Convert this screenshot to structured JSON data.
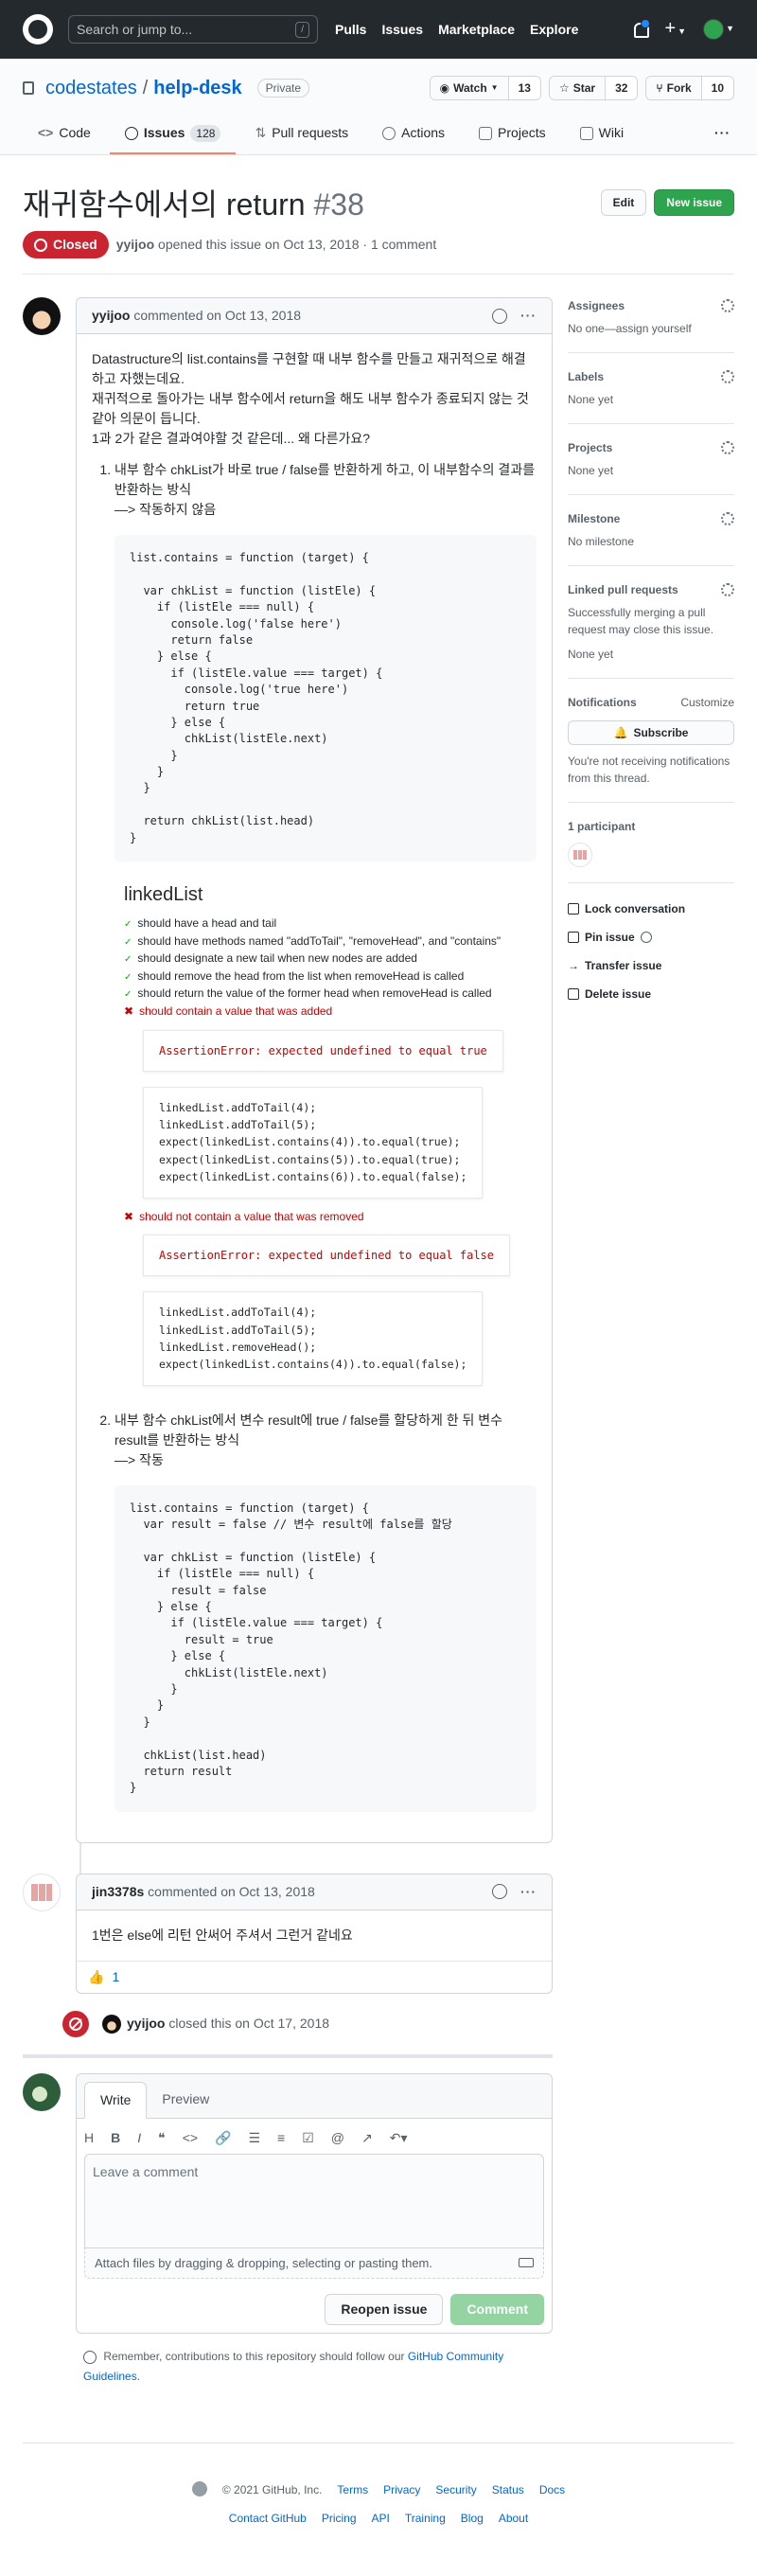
{
  "header": {
    "search_placeholder": "Search or jump to...",
    "slash": "/",
    "nav": [
      "Pulls",
      "Issues",
      "Marketplace",
      "Explore"
    ]
  },
  "repo": {
    "owner": "codestates",
    "name": "help-desk",
    "visibility": "Private",
    "watch_label": "Watch",
    "watch_count": "13",
    "star_label": "Star",
    "star_count": "32",
    "fork_label": "Fork",
    "fork_count": "10",
    "tabs": [
      {
        "label": "Code"
      },
      {
        "label": "Issues",
        "count": "128"
      },
      {
        "label": "Pull requests"
      },
      {
        "label": "Actions"
      },
      {
        "label": "Projects"
      },
      {
        "label": "Wiki"
      }
    ],
    "more": "···"
  },
  "issue": {
    "title": "재귀함수에서의 return",
    "number": "#38",
    "edit_label": "Edit",
    "new_issue_label": "New issue",
    "state": "Closed",
    "author": "yyijoo",
    "opened_text": "opened this issue on Oct 13, 2018 · 1 comment"
  },
  "comment1": {
    "author": "yyijoo",
    "meta": "commented on Oct 13, 2018",
    "p1": "Datastructure의 list.contains를 구현할 때 내부 함수를 만들고 재귀적으로 해결하고 자했는데요.",
    "p2": "재귀적으로 돌아가는 내부 함수에서 return을 해도 내부 함수가 종료되지 않는 것 같아 의문이 듭니다.",
    "p3": "1과 2가 같은 결과여야할 것 같은데... 왜 다른가요?",
    "item1_a": "내부 함수 chkList가 바로 true / false를 반환하게 하고, 이 내부함수의 결과를 반환하는 방식",
    "item1_b": "—> 작동하지 않음",
    "code1": "list.contains = function (target) {\n\n  var chkList = function (listEle) {\n    if (listEle === null) {\n      console.log('false here')\n      return false\n    } else {\n      if (listEle.value === target) {\n        console.log('true here')\n        return true\n      } else {\n        chkList(listEle.next)\n      }\n    }\n  }\n\n  return chkList(list.head)\n}",
    "mocha_title": "linkedList",
    "mocha_pass": [
      "should have a head and tail",
      "should have methods named \"addToTail\", \"removeHead\", and \"contains\"",
      "should designate a new tail when new nodes are added",
      "should remove the head from the list when removeHead is called",
      "should return the value of the former head when removeHead is called"
    ],
    "fail1": "should contain a value that was added",
    "err1": "AssertionError: expected undefined to equal true",
    "src1": "linkedList.addToTail(4);\nlinkedList.addToTail(5);\nexpect(linkedList.contains(4)).to.equal(true);\nexpect(linkedList.contains(5)).to.equal(true);\nexpect(linkedList.contains(6)).to.equal(false);",
    "fail2": "should not contain a value that was removed",
    "err2": "AssertionError: expected undefined to equal false",
    "src2": "linkedList.addToTail(4);\nlinkedList.addToTail(5);\nlinkedList.removeHead();\nexpect(linkedList.contains(4)).to.equal(false);",
    "item2_a": "내부 함수 chkList에서 변수 result에 true / false를 할당하게 한 뒤 변수 result를 반환하는 방식",
    "item2_b": "—> 작동",
    "code2": "list.contains = function (target) {\n  var result = false // 변수 result에 false를 할당\n\n  var chkList = function (listEle) {\n    if (listEle === null) {\n      result = false\n    } else {\n      if (listEle.value === target) {\n        result = true\n      } else {\n        chkList(listEle.next)\n      }\n    }\n  }\n\n  chkList(list.head)\n  return result\n}"
  },
  "comment2": {
    "author": "jin3378s",
    "meta": "commented on Oct 13, 2018",
    "body": "1번은 else에 리턴 안써어 주셔서 그런거 같네요",
    "reaction_emoji": "👍",
    "reaction_count": "1"
  },
  "event": {
    "actor": "yyijoo",
    "text": "closed this on Oct 17, 2018"
  },
  "editor": {
    "tab_write": "Write",
    "tab_preview": "Preview",
    "placeholder": "Leave a comment",
    "attach_text": "Attach files by dragging & dropping, selecting or pasting them.",
    "reopen_label": "Reopen issue",
    "comment_label": "Comment",
    "note_prefix": "Remember, contributions to this repository should follow our",
    "note_link": "GitHub Community Guidelines",
    "note_suffix": "."
  },
  "sidebar": {
    "assignees": "Assignees",
    "assignees_value": "No one—assign yourself",
    "labels": "Labels",
    "labels_value": "None yet",
    "projects": "Projects",
    "projects_value": "None yet",
    "milestone": "Milestone",
    "milestone_value": "No milestone",
    "linked": "Linked pull requests",
    "linked_desc": "Successfully merging a pull request may close this issue.",
    "linked_value": "None yet",
    "notifications": "Notifications",
    "customize": "Customize",
    "subscribe": "Subscribe",
    "notif_desc": "You're not receiving notifications from this thread.",
    "participants": "1 participant",
    "lock": "Lock conversation",
    "pin": "Pin issue",
    "transfer": "Transfer issue",
    "delete": "Delete issue"
  },
  "footer": {
    "copyright": "© 2021 GitHub, Inc.",
    "row1": [
      "Terms",
      "Privacy",
      "Security",
      "Status",
      "Docs"
    ],
    "row2": [
      "Contact GitHub",
      "Pricing",
      "API",
      "Training",
      "Blog",
      "About"
    ]
  }
}
